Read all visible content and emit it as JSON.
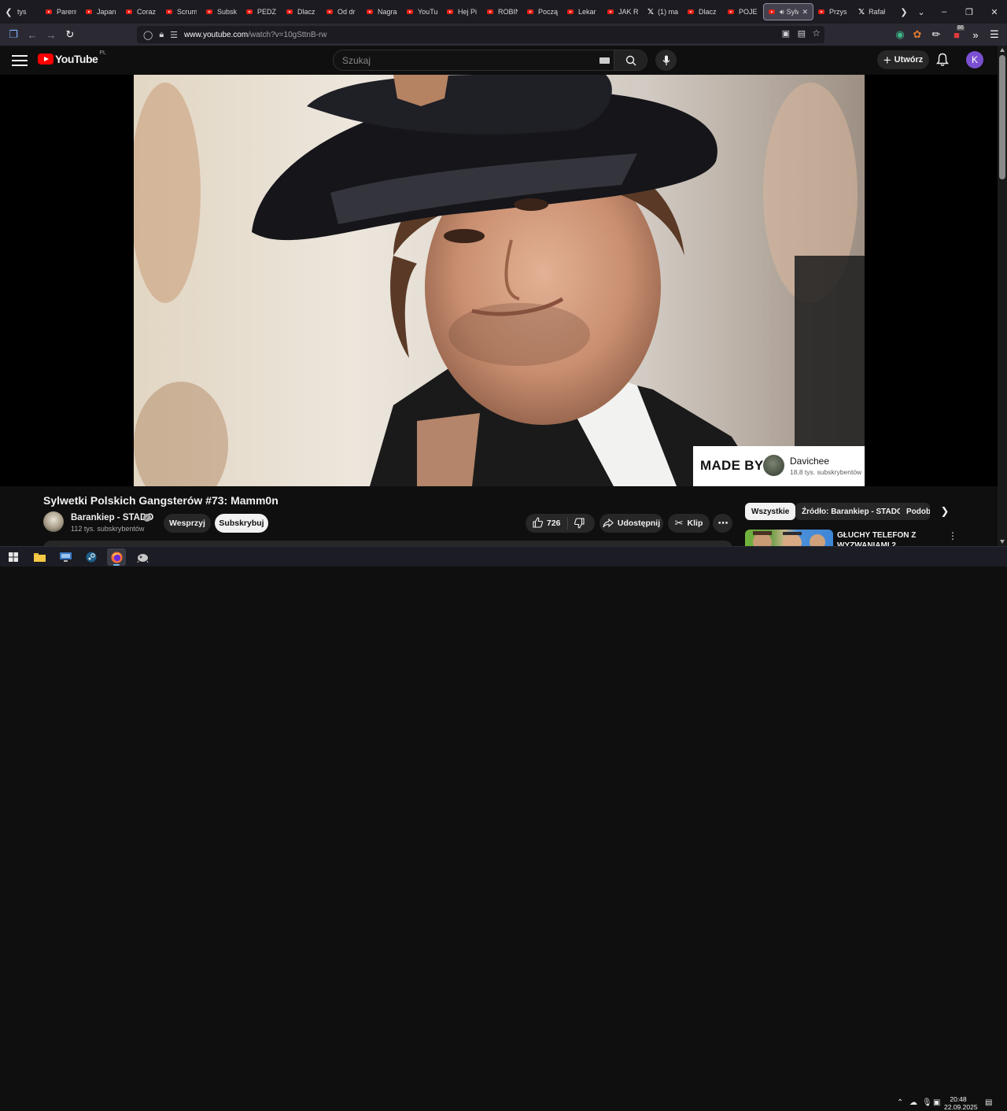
{
  "browser": {
    "tabs": [
      {
        "label": "tys",
        "icon": "none"
      },
      {
        "label": "Parent",
        "icon": "youtube"
      },
      {
        "label": "Japan",
        "icon": "youtube"
      },
      {
        "label": "Coraz",
        "icon": "youtube"
      },
      {
        "label": "Scrum",
        "icon": "youtube"
      },
      {
        "label": "Subsk",
        "icon": "youtube"
      },
      {
        "label": "PEDZ",
        "icon": "youtube"
      },
      {
        "label": "Dlacz",
        "icon": "youtube"
      },
      {
        "label": "Od dr",
        "icon": "youtube"
      },
      {
        "label": "Nagra",
        "icon": "youtube"
      },
      {
        "label": "YouTu",
        "icon": "youtube"
      },
      {
        "label": "Hej Pi",
        "icon": "youtube"
      },
      {
        "label": "ROBIN",
        "icon": "youtube"
      },
      {
        "label": "Począ",
        "icon": "youtube"
      },
      {
        "label": "Lekar",
        "icon": "youtube"
      },
      {
        "label": "JAK R",
        "icon": "youtube"
      },
      {
        "label": "(1) ma",
        "icon": "x"
      },
      {
        "label": "Dlacz",
        "icon": "youtube"
      },
      {
        "label": "POJE",
        "icon": "youtube"
      },
      {
        "label": "Sylw",
        "icon": "youtube",
        "active": true
      },
      {
        "label": "Przys",
        "icon": "youtube"
      },
      {
        "label": "Rafał",
        "icon": "x"
      }
    ],
    "url_host": "www.youtube.com",
    "url_path": "/watch?v=10gSttnB-rw",
    "extension_badge": "86"
  },
  "masthead": {
    "logo_text": "YouTube",
    "country_code": "PL",
    "search_placeholder": "Szukaj",
    "create_label": "Utwórz",
    "avatar_letter": "K"
  },
  "video": {
    "overlay_made_by": "MADE BY",
    "overlay_channel": "Davichee",
    "overlay_subs": "18,8 tys. subskrybentów",
    "title": "Sylwetki Polskich Gangsterów #73: Mamm0n",
    "channel_name": "Barankiep - STADO",
    "channel_subs": "112 tys. subskrybentów",
    "join_label": "Wesprzyj",
    "subscribe_label": "Subskrybuj",
    "likes": "726",
    "share_label": "Udostępnij",
    "clip_label": "Klip"
  },
  "sidebar": {
    "chips": [
      "Wszystkie",
      "Źródło: Barankiep - STADO",
      "Podobne"
    ],
    "rec_title": "GŁUCHY TELEFON Z WYZWANIAMI 2"
  },
  "taskbar": {
    "time": "20:48",
    "date": "22.09.2025"
  },
  "colors": {
    "accent_red": "#ff0000",
    "background": "#0f0f0f",
    "avatar_purple": "#7b4fd1"
  }
}
